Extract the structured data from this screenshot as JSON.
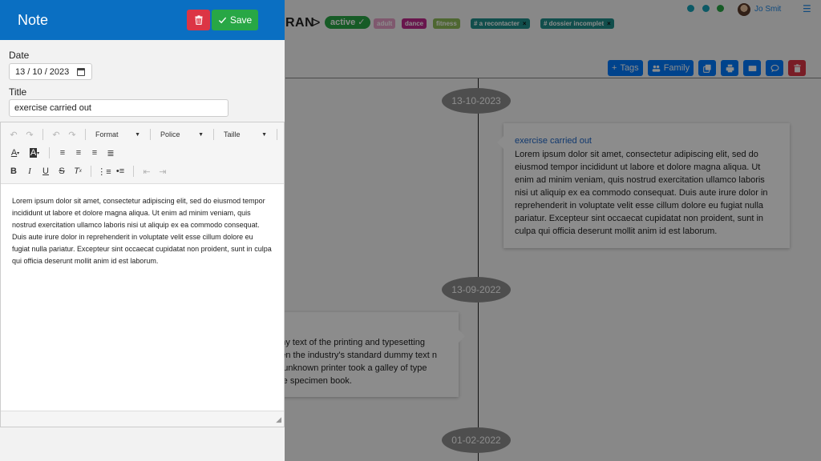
{
  "background": {
    "breadcrumb_name": "RAN",
    "breadcrumb_sep": ">",
    "status_badge": "active",
    "tags": [
      {
        "label": "adult",
        "color": "#e8a0c8"
      },
      {
        "label": "dance",
        "color": "#c0288c"
      },
      {
        "label": "fitness",
        "color": "#8fbc5a"
      },
      {
        "label": "# a recontacter",
        "color": "#1f8f8a"
      },
      {
        "label": "# dossier incomplet",
        "color": "#1f8f8a"
      }
    ],
    "user_name": "Jo Smit",
    "actions": {
      "tags_label": "Tags",
      "family_label": "Family"
    },
    "timeline": [
      {
        "date": "13-10-2023"
      },
      {
        "date": "13-09-2022"
      },
      {
        "date": "01-02-2022"
      }
    ],
    "card_right": {
      "title": "exercise carried out",
      "body": "Lorem ipsum dolor sit amet, consectetur adipiscing elit, sed do eiusmod tempor incididunt ut labore et dolore magna aliqua. Ut enim ad minim veniam, quis nostrud exercitation ullamco laboris nisi ut aliquip ex ea commodo consequat. Duis aute irure dolor in reprehenderit in voluptate velit esse cillum dolore eu fugiat nulla pariatur. Excepteur sint occaecat cupidatat non proident, sunt in culpa qui officia deserunt mollit anim id est laborum."
    },
    "card_left": {
      "body": "mmy text of the printing and typesetting been the industry's standard dummy text n an unknown printer took a galley of type type specimen book."
    }
  },
  "drawer": {
    "title": "Note",
    "save_label": "Save",
    "date_label": "Date",
    "date_value": "13 / 10 / 2023",
    "title_label": "Title",
    "title_value": "exercise carried out",
    "toolbar": {
      "format_label": "Format",
      "font_label": "Police",
      "size_label": "Taille"
    },
    "content": "Lorem ipsum dolor sit amet, consectetur adipiscing elit, sed do eiusmod tempor incididunt ut labore et dolore magna aliqua. Ut enim ad minim veniam, quis nostrud exercitation ullamco laboris nisi ut aliquip ex ea commodo consequat. Duis aute irure dolor in reprehenderit in voluptate velit esse cillum dolore eu fugiat nulla pariatur. Excepteur sint occaecat cupidatat non proident, sunt in culpa qui officia deserunt mollit anim id est laborum."
  },
  "colors": {
    "primary": "#007bff",
    "header_blue": "#0a6fc2",
    "success": "#28a745",
    "danger": "#dc3545"
  }
}
